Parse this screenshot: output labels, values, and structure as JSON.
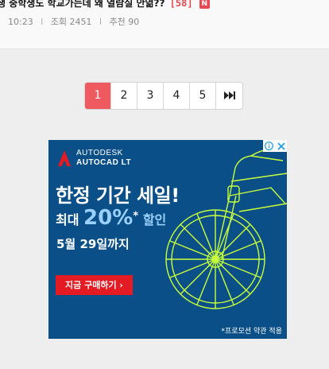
{
  "post": {
    "title": "생 중학생도 학교가는데 왜 열람실 안엶??",
    "comment_count": "[58]",
    "new_badge": "N",
    "time": "10:23",
    "separator": "l",
    "views": "조회 2451",
    "recommends": "추천 90"
  },
  "pagination": {
    "pages": [
      "1",
      "2",
      "3",
      "4",
      "5"
    ],
    "current": "1",
    "last_icon": "skip-to-last-icon"
  },
  "ad": {
    "brand": "AUTODESK",
    "product": "AUTOCAD LT",
    "headline": "한정 기간 세일!",
    "discount_prefix": "최대",
    "discount_value": "20%",
    "discount_mark": "*",
    "discount_suffix": "할인",
    "deadline": "5월 29일까지",
    "cta": "지금 구매하기 ›",
    "disclaimer": "*프로모션 약관 적용",
    "icons": [
      "adchoices-info-icon",
      "ad-close-icon",
      "autodesk-logo-icon",
      "bicycle-illustration"
    ],
    "colors": {
      "background": "#0a4f87",
      "accent": "#9ad0ff",
      "cta": "#e41b23",
      "line_art": "#c8ff3c"
    }
  }
}
